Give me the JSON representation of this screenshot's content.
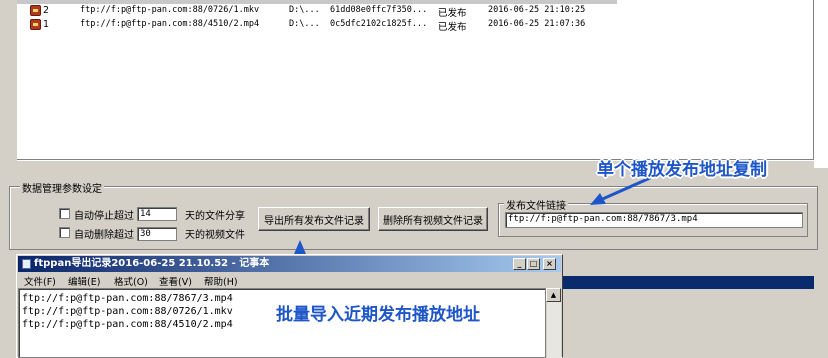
{
  "list": {
    "rows": [
      {
        "id": "2",
        "url": "ftp://f:p@ftp-pan.com:88/0726/1.mkv",
        "path": "D:\\...",
        "hash": "61dd08e0ffc7f350...",
        "status": "已发布",
        "time": "2016-06-25 21:10:25"
      },
      {
        "id": "1",
        "url": "ftp://f:p@ftp-pan.com:88/4510/2.mp4",
        "path": "D:\\...",
        "hash": "0c5dfc2102c1825f...",
        "status": "已发布",
        "time": "2016-06-25 21:07:36"
      }
    ]
  },
  "settings": {
    "group_title": "数据管理参数设定",
    "auto_stop_label": "自动停止超过",
    "auto_stop_value": "14",
    "auto_stop_suffix": "天的文件分享",
    "auto_delete_label": "自动删除超过",
    "auto_delete_value": "30",
    "auto_delete_suffix": "天的视频文件",
    "export_button": "导出所有发布文件记录",
    "delete_button": "删除所有视频文件记录",
    "publish_link_title": "发布文件链接",
    "publish_link_value": "ftp://f:p@ftp-pan.com:88/7867/3.mp4"
  },
  "annotations": {
    "copy_single": "单个播放发布地址复制",
    "batch_import": "批量导入近期发布播放地址"
  },
  "notepad": {
    "title": "ftppan导出记录2016-06-25 21.10.52 - 记事本",
    "menu": [
      "文件(F)",
      "编辑(E)",
      "格式(O)",
      "查看(V)",
      "帮助(H)"
    ],
    "lines": [
      "ftp://f:p@ftp-pan.com:88/7867/3.mp4",
      "ftp://f:p@ftp-pan.com:88/0726/1.mkv",
      "ftp://f:p@ftp-pan.com:88/4510/2.mp4"
    ],
    "controls": {
      "minimize": "_",
      "maximize": "□",
      "close": "×"
    }
  },
  "colors": {
    "annotation": "#1e56c8",
    "titlebar": "#0a246a",
    "status_icon": "#b03a1e"
  }
}
